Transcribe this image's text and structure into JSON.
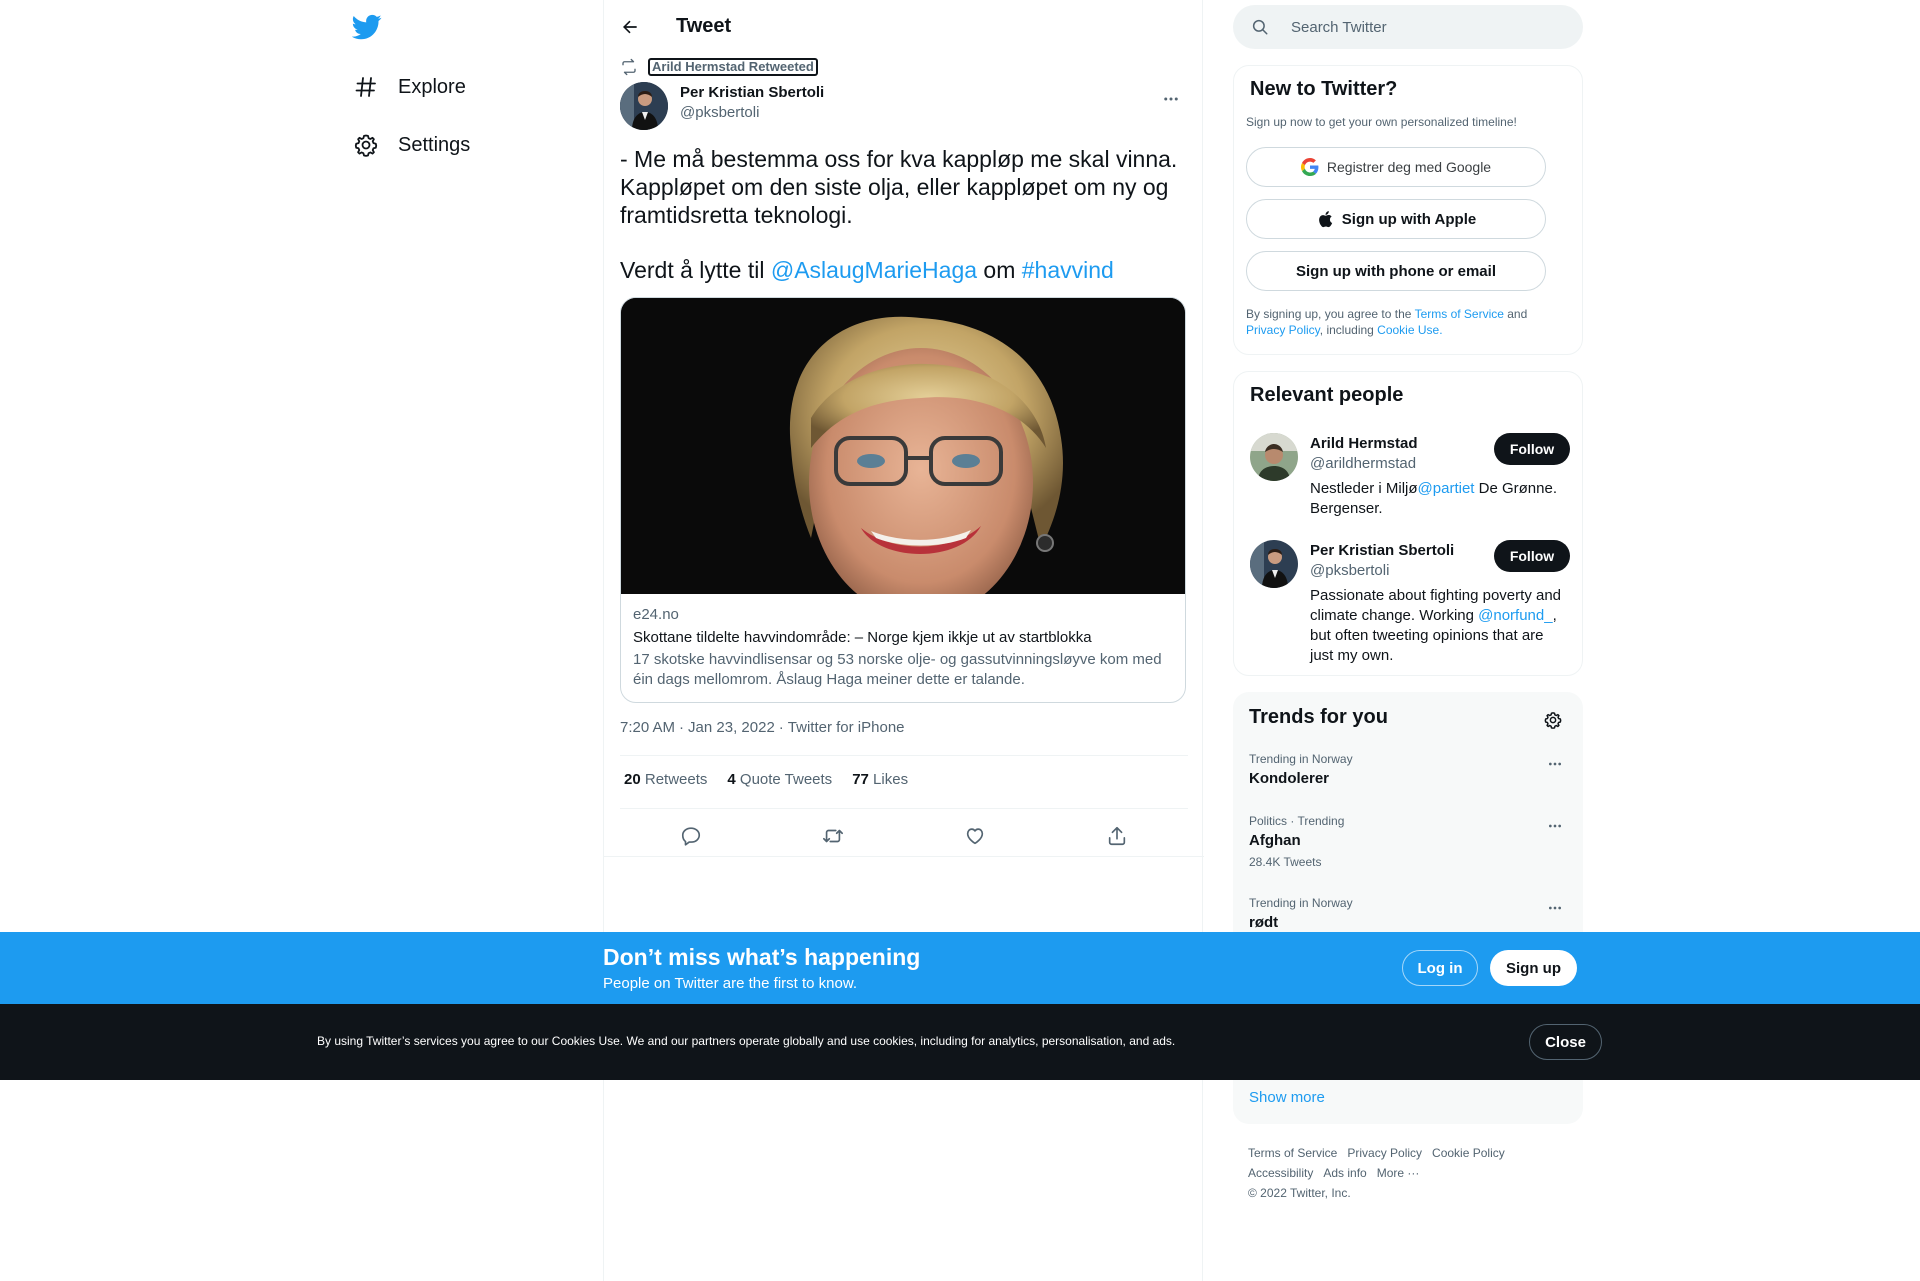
{
  "nav": {
    "items": [
      {
        "label": "Explore",
        "icon": "hashtag-icon"
      },
      {
        "label": "Settings",
        "icon": "gear-icon"
      }
    ]
  },
  "header": {
    "title": "Tweet"
  },
  "tweet": {
    "retweeted_by": "Arild Hermstad Retweeted",
    "author_name": "Per Kristian Sbertoli",
    "author_handle": "@pksbertoli",
    "text": "- Me må bestemma oss for kva kappløp me skal vinna. Kappløpet om den siste olja, eller kappløpet om ny og framtidsretta teknologi.",
    "text2_prefix": "Verdt å lytte til ",
    "mention": "@AslaugMarieHaga",
    "text2_mid": " om ",
    "hashtag": "#havvind",
    "card": {
      "domain": "e24.no",
      "title": "Skottane tildelte havvindområde: – Norge kjem ikkje ut av startblokka",
      "description": "17 skotske havvindlisensar og 53 norske olje- og gassutvinningsløyve kom med éin dags mellomrom. Åslaug Haga meiner dette er talande."
    },
    "time": "7:20 AM",
    "date": "Jan 23, 2022",
    "source": "Twitter for iPhone",
    "dot": "·",
    "stats": {
      "retweets_count": "20",
      "retweets_label": "Retweets",
      "quotes_count": "4",
      "quotes_label": "Quote Tweets",
      "likes_count": "77",
      "likes_label": "Likes"
    }
  },
  "search": {
    "placeholder": "Search Twitter"
  },
  "new_to_twitter": {
    "title": "New to Twitter?",
    "subtitle": "Sign up now to get your own personalized timeline!",
    "google_label": "Registrer deg med Google",
    "apple_label": "Sign up with Apple",
    "phone_label": "Sign up with phone or email",
    "terms_pre": "By signing up, you agree to the ",
    "terms_link": "Terms of Service",
    "terms_and": " and ",
    "privacy_link": "Privacy Policy",
    "terms_incl": ", including ",
    "cookie_link": "Cookie Use."
  },
  "relevant": {
    "title": "Relevant people",
    "people": [
      {
        "name": "Arild Hermstad",
        "handle": "@arildhermstad",
        "follow": "Follow",
        "bio_pre": "Nestleder i Miljø",
        "bio_link": "@partiet",
        "bio_post": " De Grønne. Bergenser."
      },
      {
        "name": "Per Kristian Sbertoli",
        "handle": "@pksbertoli",
        "follow": "Follow",
        "bio_pre": "Passionate about fighting poverty and climate change. Working ",
        "bio_link": "@norfund_",
        "bio_post": ", but often tweeting opinions that are just my own."
      }
    ]
  },
  "trends": {
    "title": "Trends for you",
    "items": [
      {
        "context": "Trending in Norway",
        "name": "Kondolerer",
        "count": ""
      },
      {
        "context": "Politics · Trending",
        "name": "Afghan",
        "count": "28.4K Tweets"
      },
      {
        "context": "Trending in Norway",
        "name": "rødt",
        "count": ""
      }
    ],
    "show_more": "Show more"
  },
  "footer": {
    "links": [
      "Terms of Service",
      "Privacy Policy",
      "Cookie Policy",
      "Accessibility",
      "Ads info",
      "More ···"
    ],
    "copyright": "© 2022 Twitter, Inc."
  },
  "bottombar": {
    "title": "Don’t miss what’s happening",
    "subtitle": "People on Twitter are the first to know.",
    "login": "Log in",
    "signup": "Sign up"
  },
  "cookiebar": {
    "text": "By using Twitter’s services you agree to our Cookies Use. We and our partners operate globally and use cookies, including for analytics, personalisation, and ads.",
    "close": "Close"
  },
  "colors": {
    "accent": "#1d9bf0",
    "text": "#0f1419",
    "muted": "#536471"
  }
}
